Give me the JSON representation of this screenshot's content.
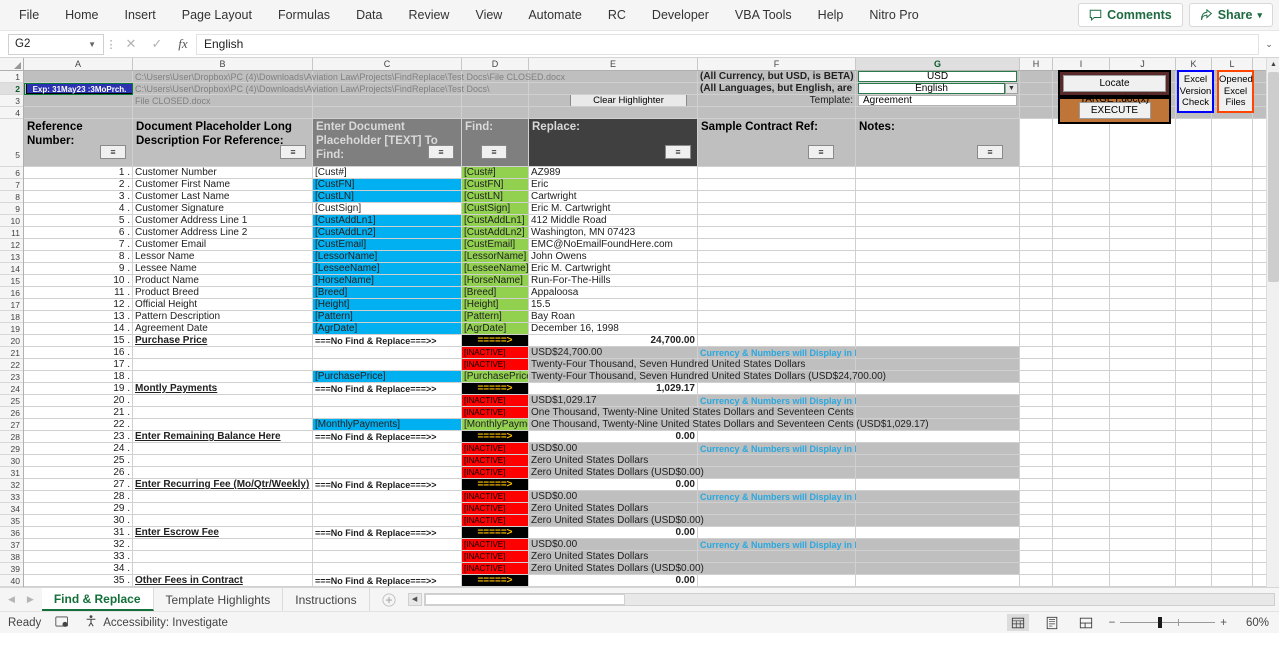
{
  "ribbon": {
    "tabs": [
      "File",
      "Home",
      "Insert",
      "Page Layout",
      "Formulas",
      "Data",
      "Review",
      "View",
      "Automate",
      "RC",
      "Developer",
      "VBA Tools",
      "Help",
      "Nitro Pro"
    ],
    "comments_label": "Comments",
    "share_label": "Share",
    "accent": "#1e6b41"
  },
  "formula_bar": {
    "name_box": "G2",
    "cancel_icon": "✕",
    "confirm_icon": "✓",
    "fx_label": "fx",
    "value": "English",
    "expand_icon": "⌄"
  },
  "grid": {
    "columns": [
      "A",
      "B",
      "C",
      "D",
      "E",
      "F",
      "G",
      "H",
      "I",
      "J",
      "K",
      "L"
    ],
    "selected_column": "G",
    "rows": [
      "1",
      "2",
      "3",
      "4",
      "5",
      "6",
      "7",
      "8",
      "9",
      "10",
      "11",
      "12",
      "13",
      "14",
      "15",
      "16",
      "17",
      "18",
      "19",
      "20",
      "21",
      "22",
      "23",
      "24",
      "25",
      "26",
      "27",
      "28",
      "29",
      "30",
      "31",
      "32",
      "33",
      "34",
      "35",
      "36",
      "37",
      "38",
      "39",
      "40"
    ],
    "selected_row": "2"
  },
  "top": {
    "exp_badge": "Exp: 31May23 :3MoPrch.",
    "path_row1": "C:\\Users\\User\\Dropbox\\PC (4)\\Downloads\\Aviation Law\\Projects\\FindReplace\\Test Docs\\File CLOSED.docx",
    "path_row2": "C:\\Users\\User\\Dropbox\\PC (4)\\Downloads\\Aviation Law\\Projects\\FindReplace\\Test Docs\\",
    "path_row3": "File CLOSED.docx",
    "currency_note": "(All Currency, but USD, is BETA) - Currency:",
    "language_note": "(All Languages, but English, are BETA) - Language:",
    "template_label": "Template:",
    "clear_highlighter": "Clear Highlighter",
    "currency_value": "USD",
    "language_value": "English",
    "template_value": "Agreement"
  },
  "buttons": {
    "locate": "Locate TARGET.doc(x)",
    "execute": "EXECUTE",
    "excel_version_check": "Excel Version Check",
    "opened_excel_files": "Opened Excel Files"
  },
  "headers": {
    "ref_number": "Reference Number:",
    "long_desc": "Document Placeholder Long Description For Reference:",
    "enter_placeholder": "Enter Document Placeholder [TEXT] To Find:",
    "find": "Find:",
    "replace": "Replace:",
    "sample_contract_ref": "Sample Contract Ref:",
    "notes": "Notes:",
    "filter_icon": "≡"
  },
  "table_rows": [
    {
      "n": "1 .",
      "desc": "Customer Number",
      "ph": "[Cust#]",
      "phfill": "white",
      "find": "[Cust#]",
      "rep": "AZ989"
    },
    {
      "n": "2 .",
      "desc": "Customer First Name",
      "ph": "[CustFN]",
      "phfill": "cyan",
      "find": "[CustFN]",
      "rep": "Eric"
    },
    {
      "n": "3 .",
      "desc": "Customer Last Name",
      "ph": "[CustLN]",
      "phfill": "cyan",
      "find": "[CustLN]",
      "rep": "Cartwright"
    },
    {
      "n": "4 .",
      "desc": "Customer Signature",
      "ph": "[CustSign]",
      "phfill": "white",
      "find": "[CustSign]",
      "rep": "Eric M. Cartwright"
    },
    {
      "n": "5 .",
      "desc": "Customer Address Line 1",
      "ph": "[CustAddLn1]",
      "phfill": "cyan",
      "find": "[CustAddLn1]",
      "rep": "412 Middle Road"
    },
    {
      "n": "6 .",
      "desc": "Customer Address Line 2",
      "ph": "[CustAddLn2]",
      "phfill": "cyan",
      "find": "[CustAddLn2]",
      "rep": "Washington, MN 07423"
    },
    {
      "n": "7 .",
      "desc": "Customer Email",
      "ph": "[CustEmail]",
      "phfill": "cyan",
      "find": "[CustEmail]",
      "rep": "EMC@NoEmailFoundHere.com"
    },
    {
      "n": "8 .",
      "desc": "Lessor Name",
      "ph": "[LessorName]",
      "phfill": "cyan",
      "find": "[LessorName]",
      "rep": "John Owens"
    },
    {
      "n": "9 .",
      "desc": "Lessee Name",
      "ph": "[LesseeName]",
      "phfill": "cyan",
      "find": "[LesseeName]",
      "rep": "Eric M. Cartwright"
    },
    {
      "n": "10 .",
      "desc": "Product Name",
      "ph": "[HorseName]",
      "phfill": "cyan",
      "find": "[HorseName]",
      "rep": "Run-For-The-Hills"
    },
    {
      "n": "11 .",
      "desc": "Product Breed",
      "ph": "[Breed]",
      "phfill": "cyan",
      "find": "[Breed]",
      "rep": "Appaloosa"
    },
    {
      "n": "12 .",
      "desc": "Official Height",
      "ph": "[Height]",
      "phfill": "cyan",
      "find": "[Height]",
      "rep": "15.5"
    },
    {
      "n": "13 .",
      "desc": "Pattern Description",
      "ph": "[Pattern]",
      "phfill": "cyan",
      "find": "[Pattern]",
      "rep": "Bay Roan"
    },
    {
      "n": "14 .",
      "desc": "Agreement Date",
      "ph": "[AgrDate]",
      "phfill": "cyan",
      "find": "[AgrDate]",
      "rep": "December 16, 1998"
    }
  ],
  "money_blocks": [
    {
      "title_n": "15 .",
      "title": "Purchase Price",
      "nofind": "===No Find & Replace===>>",
      "arrow": "=====>",
      "amount": "24,700.00",
      "r2_n": "16 .",
      "r2_find": "[INACTIVE]",
      "r2_rep": "USD$24,700.00",
      "r2_note": "Currency & Numbers will Display in English",
      "r3_n": "17 .",
      "r3_find": "[INACTIVE]",
      "r3_rep": "Twenty-Four Thousand, Seven Hundred  United States Dollars",
      "r4_n": "18 .",
      "r4_ph": "[PurchasePrice]",
      "r4_find": "[PurchasePrice]",
      "r4_rep": "Twenty-Four Thousand, Seven Hundred  United States Dollars (USD$24,700.00)"
    },
    {
      "title_n": "19 .",
      "title": "Montly Payments",
      "nofind": "===No Find & Replace===>>",
      "arrow": "=====>",
      "amount": "1,029.17",
      "r2_n": "20 .",
      "r2_find": "[INACTIVE]",
      "r2_rep": "USD$1,029.17",
      "r2_note": "Currency & Numbers will Display in English",
      "r3_n": "21 .",
      "r3_find": "[INACTIVE]",
      "r3_rep": "One Thousand, Twenty-Nine United States Dollars and Seventeen Cents",
      "r4_n": "22 .",
      "r4_ph": "[MonthlyPayments]",
      "r4_find": "[MonthlyPayments]",
      "r4_rep": "One Thousand, Twenty-Nine United States Dollars and Seventeen Cents (USD$1,029.17)"
    },
    {
      "title_n": "23 .",
      "title": "Enter Remaining Balance Here",
      "nofind": "===No Find & Replace===>>",
      "arrow": "=====>",
      "amount": "0.00",
      "r2_n": "24 .",
      "r2_find": "[INACTIVE]",
      "r2_rep": "USD$0.00",
      "r2_note": "Currency & Numbers will Display in English",
      "r3_n": "25 .",
      "r3_find": "[INACTIVE]",
      "r3_rep": "Zero United States Dollars",
      "r4_n": "26 .",
      "r4_ph": "",
      "r4_find": "[INACTIVE]",
      "r4_rep": "Zero United States Dollars (USD$0.00)"
    },
    {
      "title_n": "27 .",
      "title": "Enter Recurring Fee (Mo/Qtr/Weekly)",
      "nofind": "===No Find & Replace===>>",
      "arrow": "=====>",
      "amount": "0.00",
      "r2_n": "28 .",
      "r2_find": "[INACTIVE]",
      "r2_rep": "USD$0.00",
      "r2_note": "Currency & Numbers will Display in English",
      "r3_n": "29 .",
      "r3_find": "[INACTIVE]",
      "r3_rep": "Zero United States Dollars",
      "r4_n": "30 .",
      "r4_ph": "",
      "r4_find": "[INACTIVE]",
      "r4_rep": "Zero United States Dollars (USD$0.00)"
    },
    {
      "title_n": "31 .",
      "title": "Enter Escrow Fee",
      "nofind": "===No Find & Replace===>>",
      "arrow": "=====>",
      "amount": "0.00",
      "r2_n": "32 .",
      "r2_find": "[INACTIVE]",
      "r2_rep": "USD$0.00",
      "r2_note": "Currency & Numbers will Display in English",
      "r3_n": "33 .",
      "r3_find": "[INACTIVE]",
      "r3_rep": "Zero United States Dollars",
      "r4_n": "34 .",
      "r4_ph": "",
      "r4_find": "[INACTIVE]",
      "r4_rep": "Zero United States Dollars (USD$0.00)"
    }
  ],
  "last_row": {
    "n": "35 .",
    "title": "Other Fees in Contract",
    "nofind": "===No Find & Replace===>>",
    "arrow": "=====>",
    "amount": "0.00"
  },
  "sheet_tabs": [
    {
      "label": "Find & Replace",
      "active": true
    },
    {
      "label": "Template Highlights",
      "active": false
    },
    {
      "label": "Instructions",
      "active": false
    }
  ],
  "add_sheet_icon": "+",
  "status": {
    "mode": "Ready",
    "accessibility": "Accessibility: Investigate",
    "zoom": "60%",
    "views": [
      "normal-view",
      "page-layout-view",
      "page-break-view"
    ]
  }
}
